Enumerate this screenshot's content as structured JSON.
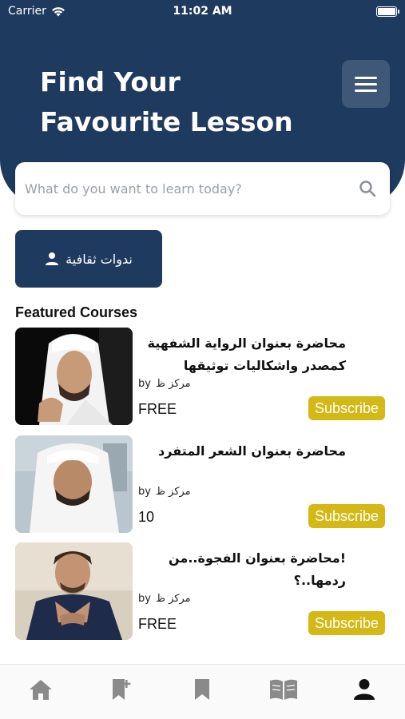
{
  "status_bar": {
    "carrier": "Carrier",
    "time": "11:02 AM"
  },
  "header": {
    "title_line1": "Find Your",
    "title_line2": "Favourite Lesson"
  },
  "search": {
    "placeholder": "What do you want to learn today?"
  },
  "category": {
    "label": "ندوات ثقافية"
  },
  "featured": {
    "title": "Featured Courses",
    "courses": [
      {
        "title": "محاضرة بعنوان الرواية الشفهية كمصدر واشكاليات توثيقها",
        "by_label": "by",
        "author": "مركز ظ",
        "price": "FREE",
        "subscribe_label": "Subscribe"
      },
      {
        "title": "محاضرة بعنوان الشعر المتفرد",
        "by_label": "by",
        "author": "مركز ظ",
        "price": "10",
        "subscribe_label": "Subscribe"
      },
      {
        "title": "!محاضرة بعنوان الفجوة..من ردمها..؟",
        "by_label": "by",
        "author": "مركز ظ",
        "price": "FREE",
        "subscribe_label": "Subscribe"
      }
    ]
  },
  "tab_bar": {
    "items": [
      "home-icon",
      "bookmark-add-icon",
      "bookmark-icon",
      "book-open-icon",
      "profile-icon"
    ],
    "active_index": 4
  },
  "colors": {
    "primary": "#1f3a5f",
    "accent": "#d4b815",
    "tab_inactive": "#8a8a8a",
    "tab_active": "#111111"
  }
}
